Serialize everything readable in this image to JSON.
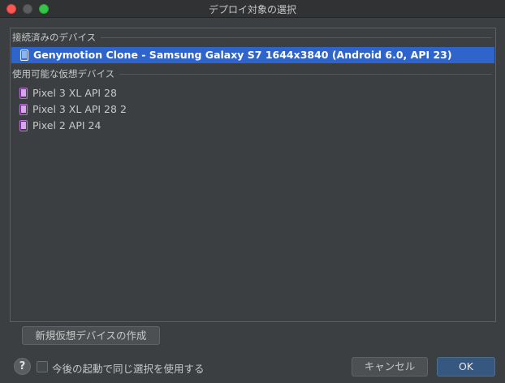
{
  "window": {
    "title": "デプロイ対象の選択"
  },
  "connected": {
    "header": "接続済みのデバイス",
    "devices": [
      {
        "label": "Genymotion Clone - Samsung Galaxy S7 1644x3840 (Android 6.0, API 23)",
        "selected": true,
        "icon": "phone-icon"
      }
    ]
  },
  "virtual": {
    "header": "使用可能な仮想デバイス",
    "devices": [
      {
        "label": "Pixel 3 XL API 28",
        "icon": "virtual-phone-icon"
      },
      {
        "label": "Pixel 3 XL API 28 2",
        "icon": "virtual-phone-icon"
      },
      {
        "label": "Pixel 2 API 24",
        "icon": "virtual-phone-icon"
      }
    ]
  },
  "footer": {
    "create_button": "新規仮想デバイスの作成",
    "help_label": "?",
    "reuse_checkbox_label": "今後の起動で同じ選択を使用する",
    "reuse_checked": false,
    "cancel_button": "キャンセル",
    "ok_button": "OK"
  },
  "colors": {
    "background": "#3c3f41",
    "selection": "#2f65ca",
    "ok_button": "#365880",
    "virtual_icon": "#b86bd6"
  }
}
